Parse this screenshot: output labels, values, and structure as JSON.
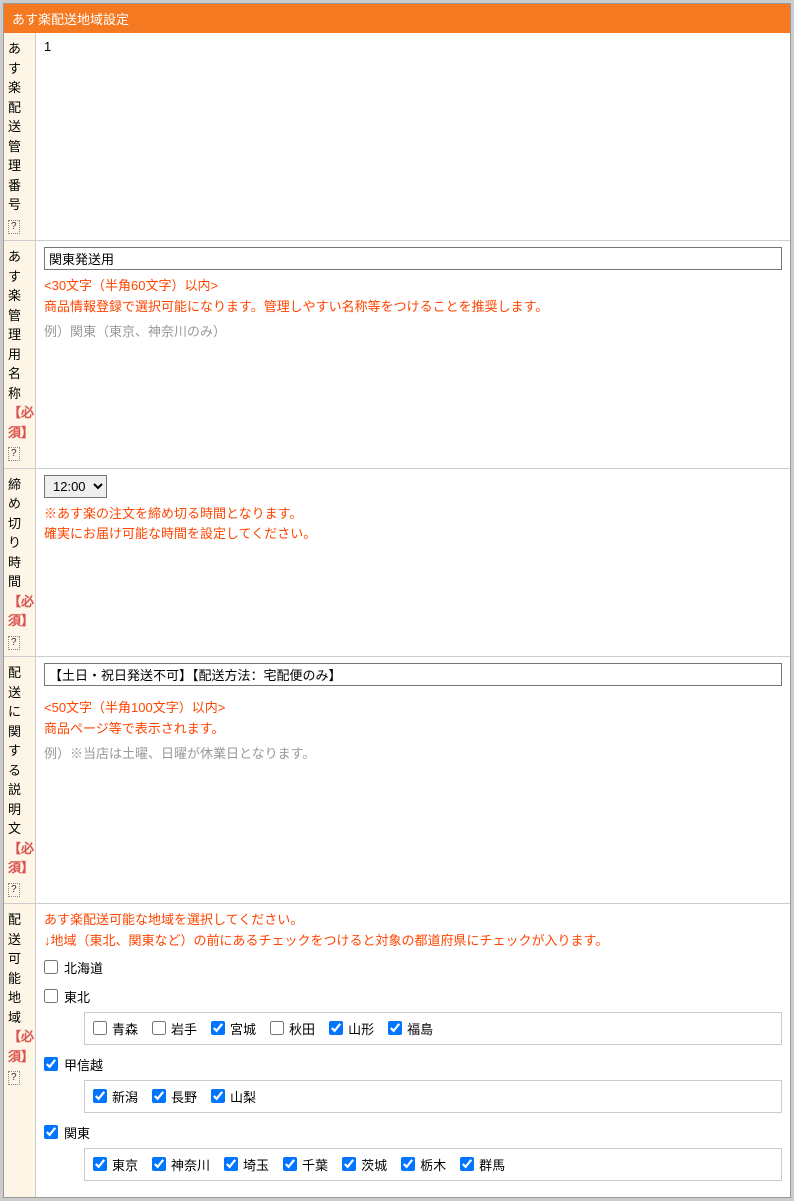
{
  "header": {
    "title": "あす楽配送地域設定"
  },
  "row1": {
    "label": "あす楽配送管理番号",
    "value": "1"
  },
  "row2": {
    "label_parts": [
      "あす楽管理用名称"
    ],
    "req": "【必須】",
    "value": "関東発送用",
    "help1": "<30文字（半角60文字）以内>",
    "help2": "商品情報登録で選択可能になります。管理しやすい名称等をつけることを推奨します。",
    "example": "例）関東（東京、神奈川のみ）"
  },
  "row3": {
    "label": "締め切り時間",
    "req": "【必須】",
    "selected": "12:00",
    "help1": "※あす楽の注文を締め切る時間となります。",
    "help2": "確実にお届け可能な時間を設定してください。"
  },
  "row4": {
    "label": "配送に関する説明文",
    "req": "【必須】",
    "value": "【土日・祝日発送不可】【配送方法：宅配便のみ】",
    "help1": "<50文字（半角100文字）以内>",
    "help2": "商品ページ等で表示されます。",
    "example": "例）※当店は土曜、日曜が休業日となります。"
  },
  "row5": {
    "label": "配送可能地域",
    "req": "【必須】",
    "help1": "あす楽配送可能な地域を選択してください。",
    "help2": "↓地域（東北、関東など）の前にあるチェックをつけると対象の都道府県にチェックが入ります。",
    "regions": [
      {
        "name": "北海道",
        "checked": false,
        "children": []
      },
      {
        "name": "東北",
        "checked": false,
        "children": [
          {
            "name": "青森",
            "checked": false
          },
          {
            "name": "岩手",
            "checked": false
          },
          {
            "name": "宮城",
            "checked": true
          },
          {
            "name": "秋田",
            "checked": false
          },
          {
            "name": "山形",
            "checked": true
          },
          {
            "name": "福島",
            "checked": true
          }
        ]
      },
      {
        "name": "甲信越",
        "checked": true,
        "children": [
          {
            "name": "新潟",
            "checked": true
          },
          {
            "name": "長野",
            "checked": true
          },
          {
            "name": "山梨",
            "checked": true
          }
        ]
      },
      {
        "name": "関東",
        "checked": true,
        "children": [
          {
            "name": "東京",
            "checked": true
          },
          {
            "name": "神奈川",
            "checked": true
          },
          {
            "name": "埼玉",
            "checked": true
          },
          {
            "name": "千葉",
            "checked": true
          },
          {
            "name": "茨城",
            "checked": true
          },
          {
            "name": "栃木",
            "checked": true
          },
          {
            "name": "群馬",
            "checked": true
          }
        ]
      }
    ]
  },
  "help_icon": "?"
}
